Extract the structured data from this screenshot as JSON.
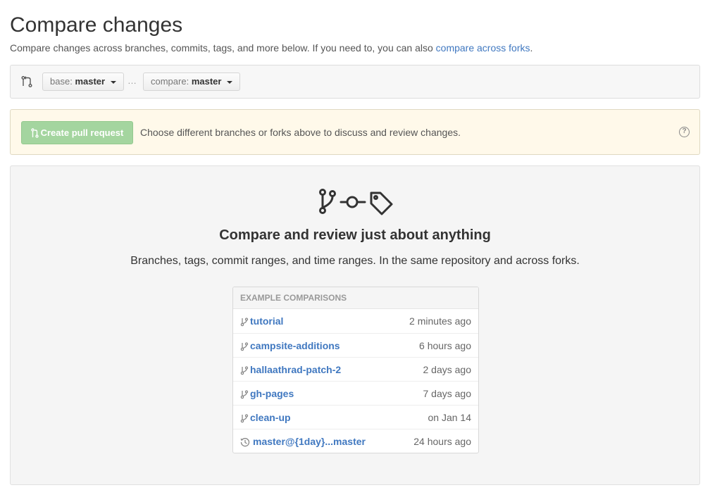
{
  "header": {
    "title": "Compare changes",
    "subtitle_prefix": "Compare changes across branches, commits, tags, and more below. If you need to, you can also ",
    "subtitle_link": "compare across forks",
    "subtitle_suffix": "."
  },
  "range": {
    "base_prefix": "base:",
    "base_value": "master",
    "separator": "…",
    "compare_prefix": "compare:",
    "compare_value": "master"
  },
  "banner": {
    "button_label": "Create pull request",
    "message": "Choose different branches or forks above to discuss and review changes.",
    "help_glyph": "?"
  },
  "blank_slate": {
    "title": "Compare and review just about anything",
    "description": "Branches, tags, commit ranges, and time ranges. In the same repository and across forks.",
    "examples_header": "EXAMPLE COMPARISONS",
    "examples": [
      {
        "name": "tutorial",
        "time": "2 minutes ago",
        "icon": "branch-icon"
      },
      {
        "name": "campsite-additions",
        "time": "6 hours ago",
        "icon": "branch-icon"
      },
      {
        "name": "hallaathrad-patch-2",
        "time": "2 days ago",
        "icon": "branch-icon"
      },
      {
        "name": "gh-pages",
        "time": "7 days ago",
        "icon": "branch-icon"
      },
      {
        "name": "clean-up",
        "time": "on Jan 14",
        "icon": "branch-icon"
      },
      {
        "name": "master@{1day}...master",
        "time": "24 hours ago",
        "icon": "history-icon"
      }
    ]
  },
  "colors": {
    "link": "#4078c0",
    "banner_bg": "#fff9ea",
    "pr_button": "#a4d59f"
  }
}
